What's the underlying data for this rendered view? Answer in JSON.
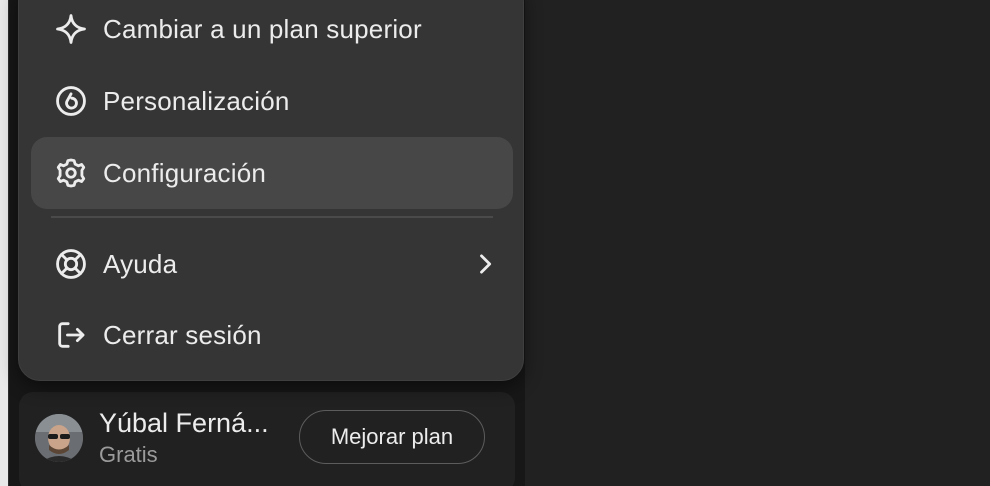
{
  "menu": {
    "items": [
      {
        "label": "Cambiar a un plan superior",
        "icon": "sparkle-icon"
      },
      {
        "label": "Personalización",
        "icon": "personalization-icon"
      },
      {
        "label": "Configuración",
        "icon": "gear-icon",
        "state": "hovered"
      },
      {
        "label": "Ayuda",
        "icon": "lifebuoy-icon",
        "has_submenu": true
      },
      {
        "label": "Cerrar sesión",
        "icon": "logout-icon"
      }
    ]
  },
  "account": {
    "name": "Yúbal Ferná...",
    "plan": "Gratis",
    "upgrade_label": "Mejorar plan"
  },
  "colors": {
    "background": "#212121",
    "menu_bg": "#353535",
    "hover_bg": "#474747",
    "text": "#ececec",
    "muted_text": "#9b9b9b"
  }
}
